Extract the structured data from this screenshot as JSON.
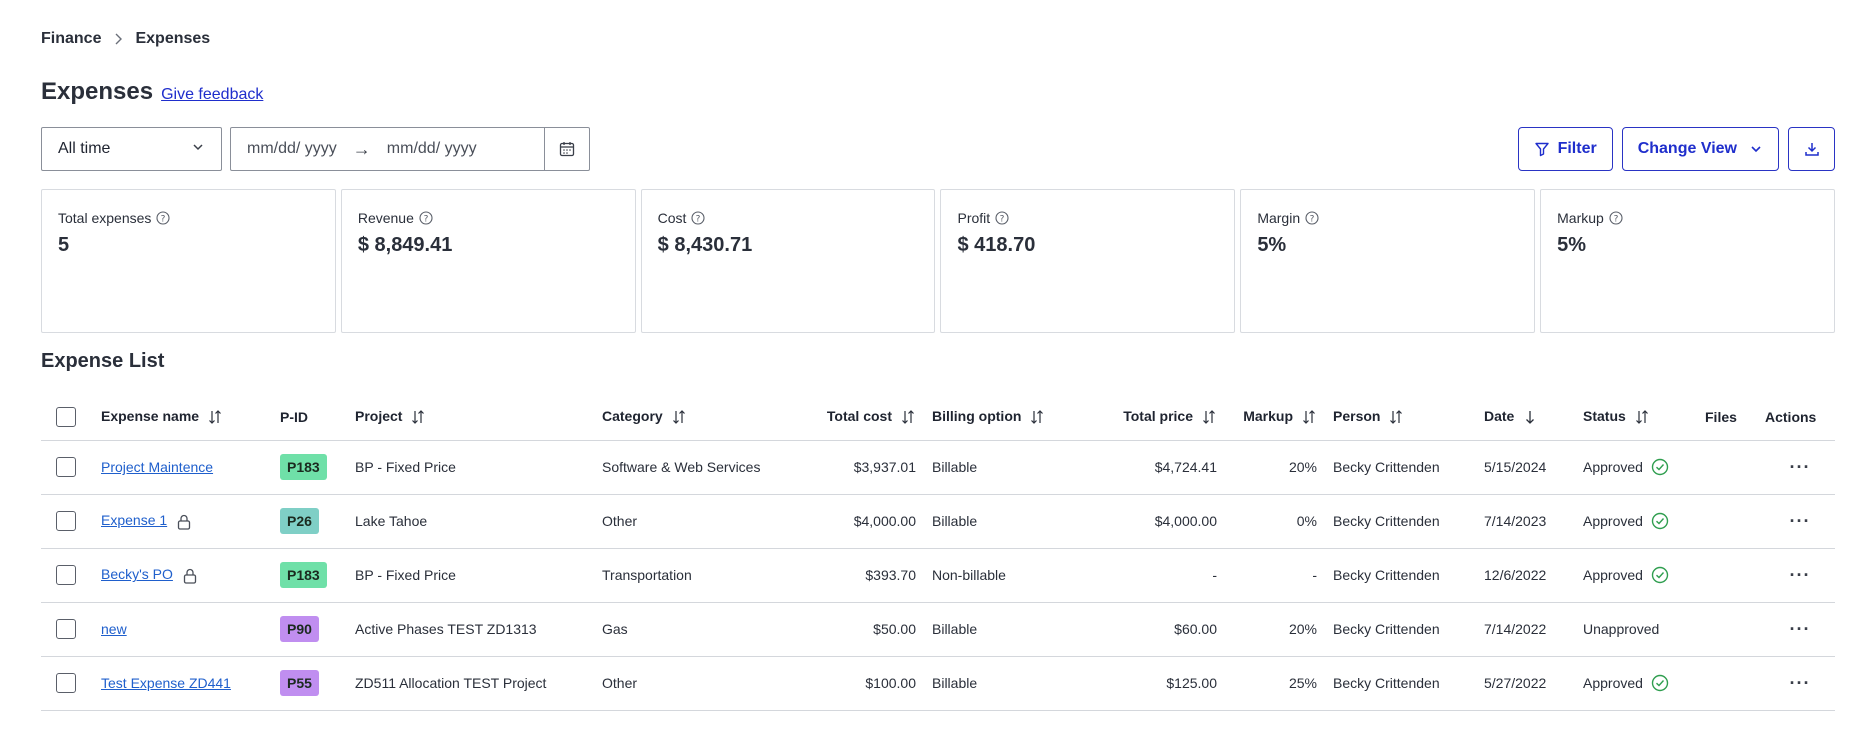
{
  "breadcrumb": {
    "parent": "Finance",
    "current": "Expenses"
  },
  "header": {
    "title": "Expenses",
    "feedback_label": "Give feedback"
  },
  "controls": {
    "range_value": "All time",
    "date_from_placeholder": "mm/dd/ yyyy",
    "date_to_placeholder": "mm/dd/ yyyy",
    "arrow": "→",
    "filter_label": "Filter",
    "change_view_label": "Change View"
  },
  "stats": [
    {
      "label": "Total expenses",
      "value": "5"
    },
    {
      "label": "Revenue",
      "value": "$ 8,849.41"
    },
    {
      "label": "Cost",
      "value": "$ 8,430.71"
    },
    {
      "label": "Profit",
      "value": "$ 418.70"
    },
    {
      "label": "Margin",
      "value": "5%"
    },
    {
      "label": "Markup",
      "value": "5%"
    }
  ],
  "list": {
    "title": "Expense List",
    "columns": {
      "name": "Expense name",
      "pid": "P-ID",
      "project": "Project",
      "category": "Category",
      "total_cost": "Total cost",
      "billing": "Billing option",
      "total_price": "Total price",
      "markup": "Markup",
      "person": "Person",
      "date": "Date",
      "status": "Status",
      "files": "Files",
      "actions": "Actions"
    },
    "rows": [
      {
        "name": "Project Maintence",
        "pid": "P183",
        "project": "BP - Fixed Price",
        "category": "Software & Web Services",
        "total_cost": "$3,937.01",
        "billing": "Billable",
        "total_price": "$4,724.41",
        "markup": "20%",
        "person": "Becky Crittenden",
        "date": "5/15/2024",
        "status": "Approved",
        "actions": "···"
      },
      {
        "name": "Expense 1",
        "pid": "P26",
        "project": "Lake Tahoe",
        "category": "Other",
        "total_cost": "$4,000.00",
        "billing": "Billable",
        "total_price": "$4,000.00",
        "markup": "0%",
        "person": "Becky Crittenden",
        "date": "7/14/2023",
        "status": "Approved",
        "actions": "···"
      },
      {
        "name": "Becky's PO",
        "pid": "P183",
        "project": "BP - Fixed Price",
        "category": "Transportation",
        "total_cost": "$393.70",
        "billing": "Non-billable",
        "total_price": "-",
        "markup": "-",
        "person": "Becky Crittenden",
        "date": "12/6/2022",
        "status": "Approved",
        "actions": "···"
      },
      {
        "name": "new",
        "pid": "P90",
        "project": "Active Phases TEST ZD1313",
        "category": "Gas",
        "total_cost": "$50.00",
        "billing": "Billable",
        "total_price": "$60.00",
        "markup": "20%",
        "person": "Becky Crittenden",
        "date": "7/14/2022",
        "status": "Unapproved",
        "actions": "···"
      },
      {
        "name": "Test Expense ZD441",
        "pid": "P55",
        "project": "ZD511 Allocation TEST Project",
        "category": "Other",
        "total_cost": "$100.00",
        "billing": "Billable",
        "total_price": "$125.00",
        "markup": "25%",
        "person": "Becky Crittenden",
        "date": "5/27/2022",
        "status": "Approved",
        "actions": "···"
      }
    ]
  },
  "colors": {
    "accent": "#1f2ecc",
    "link": "#1f5fcc",
    "pid_green": "#6fe0a8",
    "pid_teal": "#7fcfc6",
    "pid_purple": "#c08ef0",
    "approved_green": "#2f9e4f"
  }
}
